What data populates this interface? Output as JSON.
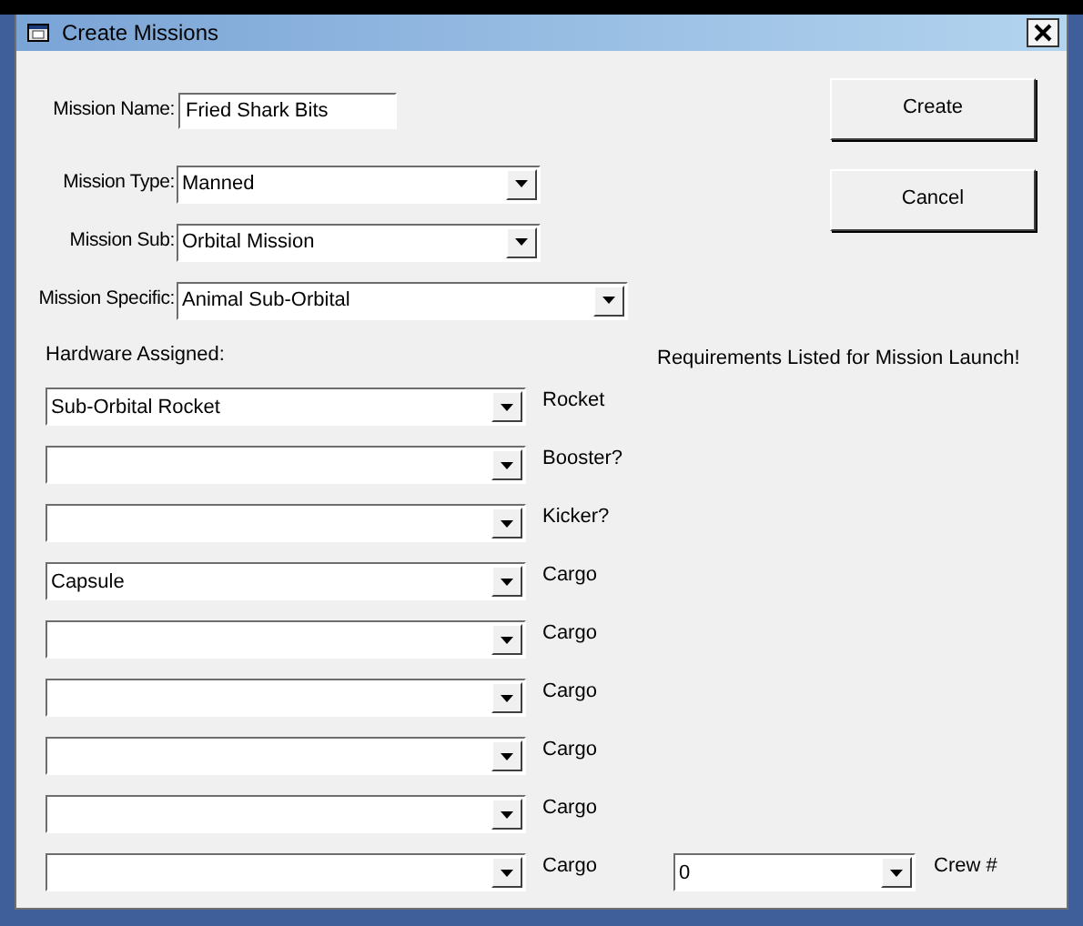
{
  "window": {
    "title": "Create Missions"
  },
  "mission_name": {
    "label": "Mission Name:",
    "value": "Fried Shark Bits"
  },
  "mission_selects": [
    {
      "label": "Mission Type:",
      "value": "Manned"
    },
    {
      "label": "Mission Sub:",
      "value": "Orbital Mission"
    },
    {
      "label": "Mission Specific:",
      "value": "Animal Sub-Orbital"
    }
  ],
  "hardware_heading": "Hardware Assigned:",
  "hardware": [
    {
      "value": "Sub-Orbital Rocket",
      "label": "Rocket"
    },
    {
      "label": "Booster?"
    },
    {
      "label": "Kicker?"
    },
    {
      "value": "Capsule",
      "label": "Cargo"
    },
    {
      "label": "Cargo"
    },
    {
      "label": "Cargo"
    },
    {
      "label": "Cargo"
    },
    {
      "label": "Cargo"
    },
    {
      "label": "Cargo"
    }
  ],
  "buttons": [
    "Create",
    "Cancel"
  ],
  "requirements_text": "Requirements Listed for Mission Launch!",
  "crew": {
    "value": "0",
    "label": "Crew #"
  }
}
